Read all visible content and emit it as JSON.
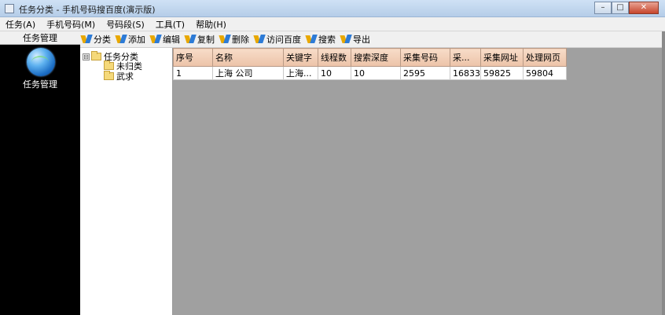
{
  "window": {
    "title": "任务分类 - 手机号码搜百度(演示版)",
    "minimize": "–",
    "maximize": "□",
    "close": "✕"
  },
  "menu": [
    "任务(A)",
    "手机号码(M)",
    "号码段(S)",
    "工具(T)",
    "帮助(H)"
  ],
  "left_nav": {
    "header": "任务管理",
    "item_label": "任务管理",
    "item_icon": "globe-icon"
  },
  "toolbar": [
    "分类",
    "添加",
    "编辑",
    "复制",
    "删除",
    "访问百度",
    "搜索",
    "导出"
  ],
  "tree": {
    "root": "任务分类",
    "root_expander": "⊟",
    "children": [
      "未归类",
      "武求"
    ]
  },
  "table": {
    "columns": [
      "序号",
      "名称",
      "关键字",
      "线程数",
      "搜索深度",
      "采集号码",
      "采...",
      "采集网址",
      "处理网页"
    ],
    "rows": [
      [
        "1",
        "上海  公司",
        "上海...",
        "10",
        "10",
        "2595",
        "16833",
        "59825",
        "59804"
      ]
    ]
  },
  "colors": {
    "title_bar": "#b5cde8",
    "header_cell": "#ecc3a8",
    "grid_background": "#a0a0a0",
    "left_panel": "#000000"
  }
}
